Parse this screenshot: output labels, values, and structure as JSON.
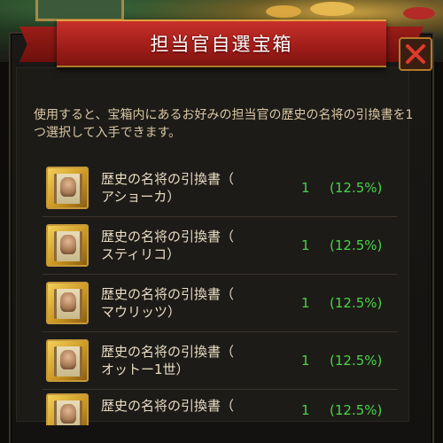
{
  "dialog": {
    "title": "担当官自選宝箱",
    "description": "使用すると、宝箱内にあるお好みの担当官の歴史の名将の引換書を1つ選択して入手できます。"
  },
  "items": [
    {
      "name_line1": "歴史の名将の引換書（",
      "name_line2": "アショーカ）",
      "quantity": "1",
      "chance": "(12.5%)"
    },
    {
      "name_line1": "歴史の名将の引換書（",
      "name_line2": "スティリコ）",
      "quantity": "1",
      "chance": "(12.5%)"
    },
    {
      "name_line1": "歴史の名将の引換書（",
      "name_line2": "マウリッツ）",
      "quantity": "1",
      "chance": "(12.5%)"
    },
    {
      "name_line1": "歴史の名将の引換書（",
      "name_line2": "オットー1世）",
      "quantity": "1",
      "chance": "(12.5%)"
    },
    {
      "name_line1": "歴史の名将の引換書（",
      "name_line2": "",
      "quantity": "1",
      "chance": "(12.5%)"
    }
  ],
  "colors": {
    "banner": "#a21e1a",
    "accent_gold": "#c59a3a",
    "value_green": "#48d448",
    "text": "#e8dcc2"
  }
}
